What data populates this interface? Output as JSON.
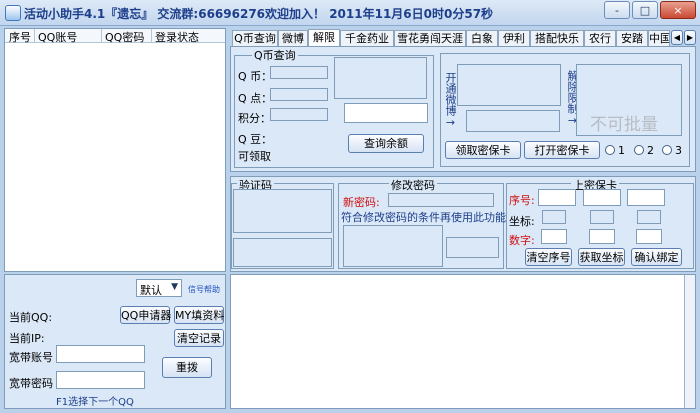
{
  "window": {
    "title": "活动小助手4.1『遗忘』 交流群:66696276欢迎加入！  2011年11月6日0时0分57秒",
    "controls": [
      "-",
      "□",
      "×"
    ]
  },
  "left_list": {
    "headers": [
      "序号",
      "QQ账号",
      "QQ密码",
      "登录状态"
    ]
  },
  "left_bottom": {
    "select_value": "默认",
    "help_link": "信号帮助",
    "current_qq_label": "当前QQ:",
    "qq_apply_button": "QQ申请器",
    "my_fill_button": "MY填资料",
    "current_ip_label": "当前IP:",
    "clear_log_button": "清空记录",
    "broadband_account_label": "宽带账号",
    "broadband_password_label": "宽带密码",
    "redial_button": "重拨",
    "hint": "F1选择下一个QQ"
  },
  "tabs": [
    "Q币查询",
    "微博",
    "解限",
    "千金药业",
    "雪花勇闯天涯",
    "白象",
    "伊利",
    "搭配快乐",
    "农行",
    "安踏",
    "中国"
  ],
  "active_tab_index": 2,
  "qb_query": {
    "group_title": "Q币查询",
    "qb_label": "Q 币：",
    "qd_label": "Q 点：",
    "points_label": "积分：",
    "qdou_label": "Q 豆：",
    "claimable_label": "可领取",
    "query_button": "查询余额"
  },
  "weibo": {
    "open_label": "开通微博→",
    "unlock_label": "解除限制→",
    "watermark": "不可批量",
    "get_card_button": "领取密保卡",
    "open_card_button": "打开密保卡",
    "radios": [
      "1",
      "2",
      "3"
    ]
  },
  "captcha": {
    "group_title": "验证码"
  },
  "change_password": {
    "group_title": "修改密码",
    "new_password_label": "新密码:",
    "note": "符合修改密码的条件再使用此功能"
  },
  "security_card": {
    "group_title": "上密保卡",
    "serial_label": "序号:",
    "coord_label": "坐标:",
    "digits_label": "数字:",
    "clear_serial_button": "清空序号",
    "get_coord_button": "获取坐标",
    "confirm_bind_button": "确认绑定"
  }
}
